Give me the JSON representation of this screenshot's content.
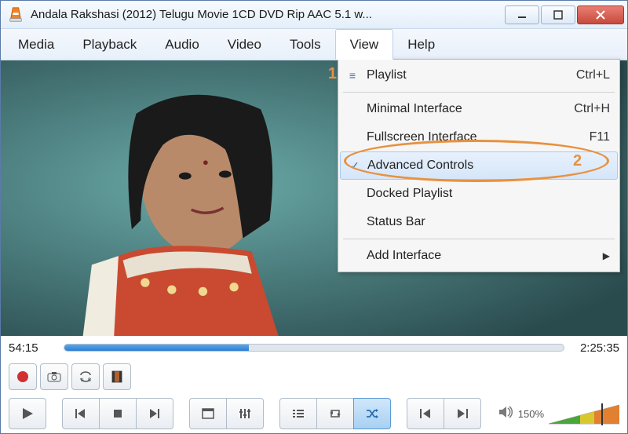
{
  "window": {
    "title": "Andala Rakshasi (2012) Telugu Movie 1CD DVD Rip AAC 5.1 w..."
  },
  "annotations": {
    "one": "1",
    "two": "2"
  },
  "menubar": {
    "media": "Media",
    "playback": "Playback",
    "audio": "Audio",
    "video": "Video",
    "tools": "Tools",
    "view": "View",
    "help": "Help"
  },
  "view_menu": {
    "playlist": {
      "label": "Playlist",
      "shortcut": "Ctrl+L"
    },
    "minimal": {
      "label": "Minimal Interface",
      "shortcut": "Ctrl+H"
    },
    "fullscreen": {
      "label": "Fullscreen Interface",
      "shortcut": "F11"
    },
    "advanced": {
      "label": "Advanced Controls",
      "check": "✓"
    },
    "docked": {
      "label": "Docked Playlist"
    },
    "statusbar": {
      "label": "Status Bar"
    },
    "addiface": {
      "label": "Add Interface"
    }
  },
  "playback": {
    "elapsed": "54:15",
    "total": "2:25:35",
    "progress_pct": 37
  },
  "volume": {
    "label": "150%"
  }
}
